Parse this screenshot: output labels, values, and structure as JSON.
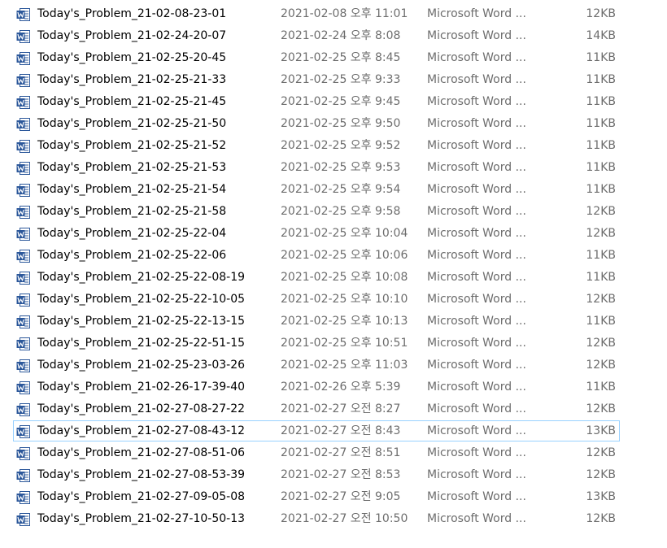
{
  "files": [
    {
      "name": "Today's_Problem_21-02-08-23-01",
      "date": "2021-02-08 오후 11:01",
      "type": "Microsoft Word ...",
      "size": "12KB"
    },
    {
      "name": "Today's_Problem_21-02-24-20-07",
      "date": "2021-02-24 오후 8:08",
      "type": "Microsoft Word ...",
      "size": "14KB"
    },
    {
      "name": "Today's_Problem_21-02-25-20-45",
      "date": "2021-02-25 오후 8:45",
      "type": "Microsoft Word ...",
      "size": "11KB"
    },
    {
      "name": "Today's_Problem_21-02-25-21-33",
      "date": "2021-02-25 오후 9:33",
      "type": "Microsoft Word ...",
      "size": "11KB"
    },
    {
      "name": "Today's_Problem_21-02-25-21-45",
      "date": "2021-02-25 오후 9:45",
      "type": "Microsoft Word ...",
      "size": "11KB"
    },
    {
      "name": "Today's_Problem_21-02-25-21-50",
      "date": "2021-02-25 오후 9:50",
      "type": "Microsoft Word ...",
      "size": "11KB"
    },
    {
      "name": "Today's_Problem_21-02-25-21-52",
      "date": "2021-02-25 오후 9:52",
      "type": "Microsoft Word ...",
      "size": "11KB"
    },
    {
      "name": "Today's_Problem_21-02-25-21-53",
      "date": "2021-02-25 오후 9:53",
      "type": "Microsoft Word ...",
      "size": "11KB"
    },
    {
      "name": "Today's_Problem_21-02-25-21-54",
      "date": "2021-02-25 오후 9:54",
      "type": "Microsoft Word ...",
      "size": "11KB"
    },
    {
      "name": "Today's_Problem_21-02-25-21-58",
      "date": "2021-02-25 오후 9:58",
      "type": "Microsoft Word ...",
      "size": "12KB"
    },
    {
      "name": "Today's_Problem_21-02-25-22-04",
      "date": "2021-02-25 오후 10:04",
      "type": "Microsoft Word ...",
      "size": "12KB"
    },
    {
      "name": "Today's_Problem_21-02-25-22-06",
      "date": "2021-02-25 오후 10:06",
      "type": "Microsoft Word ...",
      "size": "11KB"
    },
    {
      "name": "Today's_Problem_21-02-25-22-08-19",
      "date": "2021-02-25 오후 10:08",
      "type": "Microsoft Word ...",
      "size": "11KB"
    },
    {
      "name": "Today's_Problem_21-02-25-22-10-05",
      "date": "2021-02-25 오후 10:10",
      "type": "Microsoft Word ...",
      "size": "12KB"
    },
    {
      "name": "Today's_Problem_21-02-25-22-13-15",
      "date": "2021-02-25 오후 10:13",
      "type": "Microsoft Word ...",
      "size": "11KB"
    },
    {
      "name": "Today's_Problem_21-02-25-22-51-15",
      "date": "2021-02-25 오후 10:51",
      "type": "Microsoft Word ...",
      "size": "12KB"
    },
    {
      "name": "Today's_Problem_21-02-25-23-03-26",
      "date": "2021-02-25 오후 11:03",
      "type": "Microsoft Word ...",
      "size": "12KB"
    },
    {
      "name": "Today's_Problem_21-02-26-17-39-40",
      "date": "2021-02-26 오후 5:39",
      "type": "Microsoft Word ...",
      "size": "11KB"
    },
    {
      "name": "Today's_Problem_21-02-27-08-27-22",
      "date": "2021-02-27 오전 8:27",
      "type": "Microsoft Word ...",
      "size": "12KB"
    },
    {
      "name": "Today's_Problem_21-02-27-08-43-12",
      "date": "2021-02-27 오전 8:43",
      "type": "Microsoft Word ...",
      "size": "13KB"
    },
    {
      "name": "Today's_Problem_21-02-27-08-51-06",
      "date": "2021-02-27 오전 8:51",
      "type": "Microsoft Word ...",
      "size": "12KB"
    },
    {
      "name": "Today's_Problem_21-02-27-08-53-39",
      "date": "2021-02-27 오전 8:53",
      "type": "Microsoft Word ...",
      "size": "12KB"
    },
    {
      "name": "Today's_Problem_21-02-27-09-05-08",
      "date": "2021-02-27 오전 9:05",
      "type": "Microsoft Word ...",
      "size": "13KB"
    },
    {
      "name": "Today's_Problem_21-02-27-10-50-13",
      "date": "2021-02-27 오전 10:50",
      "type": "Microsoft Word ...",
      "size": "12KB"
    }
  ],
  "hovered_row_index": 19,
  "icon": "word-document-icon",
  "colors": {
    "word_blue": "#2b579a",
    "hover_border": "#99d1ff",
    "secondary_text": "#6d6d6d"
  }
}
